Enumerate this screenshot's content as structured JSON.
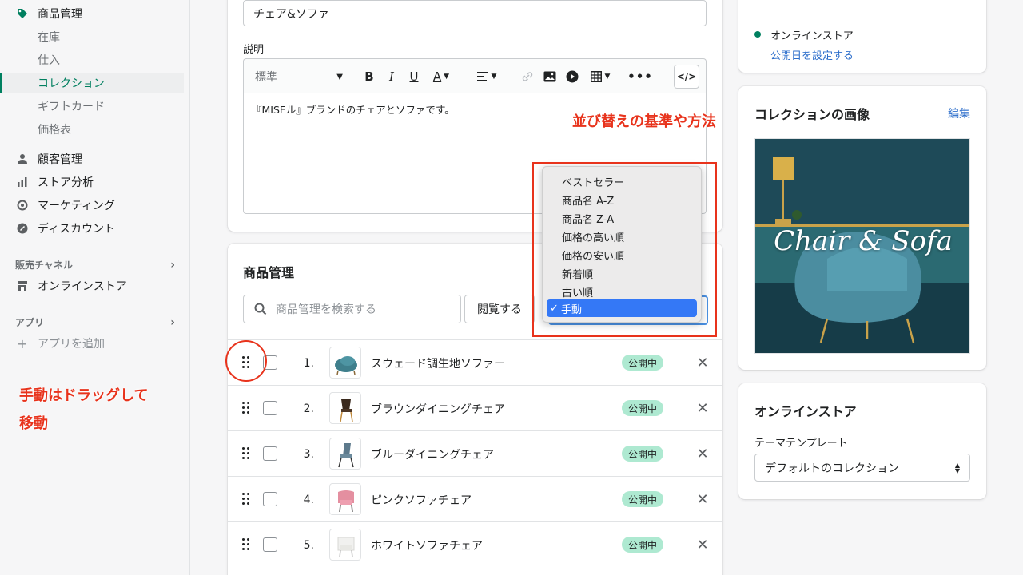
{
  "sidebar": {
    "products": "商品管理",
    "inventory": "在庫",
    "purchase": "仕入",
    "collections": "コレクション",
    "giftcards": "ギフトカード",
    "pricelist": "価格表",
    "customers": "顧客管理",
    "analytics": "ストア分析",
    "marketing": "マーケティング",
    "discounts": "ディスカウント",
    "sales_channels": "販売チャネル",
    "online_store": "オンラインストア",
    "apps": "アプリ",
    "add_app": "アプリを追加"
  },
  "title_field": {
    "value": "チェア&ソファ"
  },
  "description": {
    "label": "説明",
    "format_select": "標準",
    "text": "『MISEル』ブランドのチェアとソファです。"
  },
  "products_card": {
    "title": "商品管理",
    "search_placeholder": "商品管理を検索する",
    "browse_button": "閲覧する"
  },
  "sort_dropdown": {
    "options": [
      "ベストセラー",
      "商品名 A-Z",
      "商品名 Z-A",
      "価格の高い順",
      "価格の安い順",
      "新着順",
      "古い順"
    ],
    "selected": "手動",
    "check": "✓"
  },
  "products": [
    {
      "num": "1.",
      "name": "スウェード調生地ソファー",
      "status": "公開中"
    },
    {
      "num": "2.",
      "name": "ブラウンダイニングチェア",
      "status": "公開中"
    },
    {
      "num": "3.",
      "name": "ブルーダイニングチェア",
      "status": "公開中"
    },
    {
      "num": "4.",
      "name": "ピンクソファチェア",
      "status": "公開中"
    },
    {
      "num": "5.",
      "name": "ホワイトソファチェア",
      "status": "公開中"
    }
  ],
  "availability": {
    "channel": "オンラインストア",
    "schedule_link": "公開日を設定する"
  },
  "collection_image": {
    "title": "コレクションの画像",
    "edit": "編集",
    "image_text": "Chair & Sofa"
  },
  "theme": {
    "title": "オンラインストア",
    "label": "テーマテンプレート",
    "value": "デフォルトのコレクション"
  },
  "annotations": {
    "sort": "並び替えの基準や方法",
    "drag_line1": "手動はドラッグして",
    "drag_line2": "移動"
  },
  "colors": {
    "accent": "#008060",
    "annotation": "#e8331c",
    "badge": "#aee9d1",
    "link": "#2c6ecb"
  }
}
